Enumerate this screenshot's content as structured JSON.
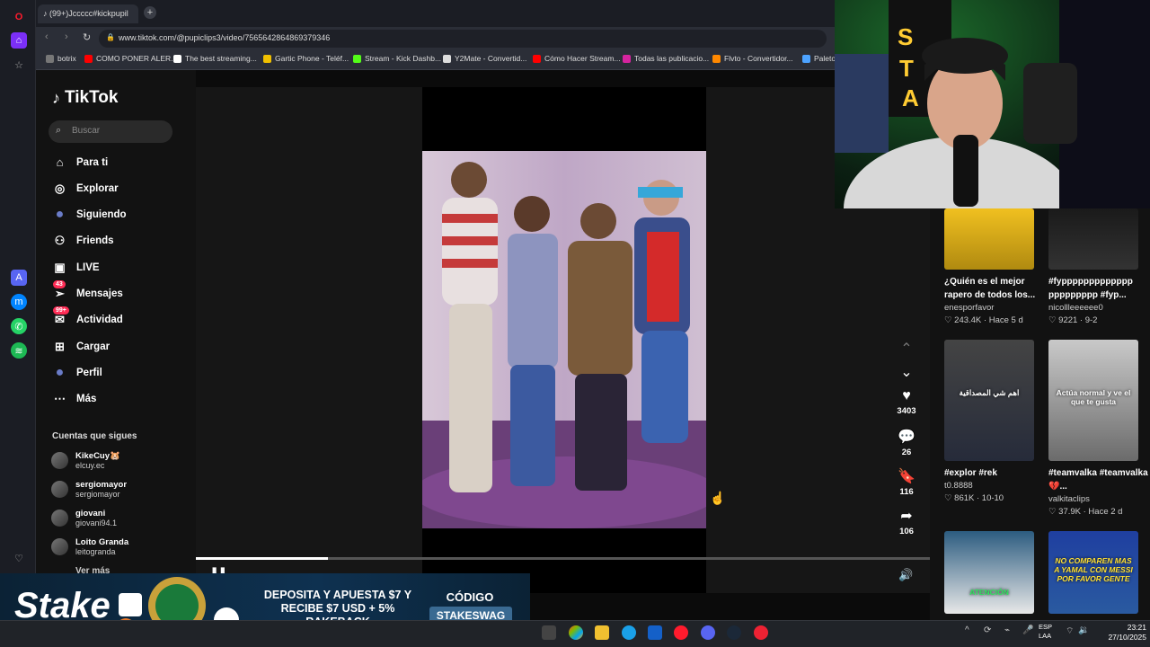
{
  "browser": {
    "tab_title": "(99+)Jccccc#kickpupil",
    "url": "www.tiktok.com/@pupiclips3/video/7565642864869379346",
    "bookmarks": [
      {
        "label": "botrix",
        "color": "#777777"
      },
      {
        "label": "COMO PONER ALER...",
        "color": "#ff0000"
      },
      {
        "label": "The best streaming...",
        "color": "#ffffff"
      },
      {
        "label": "Gartic Phone - Teléf...",
        "color": "#f0c000"
      },
      {
        "label": "Stream - Kick Dashb...",
        "color": "#53fc18"
      },
      {
        "label": "Y2Mate - Convertid...",
        "color": "#dddddd"
      },
      {
        "label": "Cómo Hacer Stream...",
        "color": "#ff0000"
      },
      {
        "label": "Todas las publicacio...",
        "color": "#d6249f"
      },
      {
        "label": "Flvto - Convertidor...",
        "color": "#ff8800"
      },
      {
        "label": "Paleto",
        "color": "#4da3ff"
      }
    ]
  },
  "tiktok": {
    "logo": "TikTok",
    "search_placeholder": "Buscar",
    "nav": [
      {
        "label": "Para ti",
        "icon": "home-icon"
      },
      {
        "label": "Explorar",
        "icon": "compass-icon"
      },
      {
        "label": "Siguiendo",
        "icon": "following-avatar-icon"
      },
      {
        "label": "Friends",
        "icon": "friends-icon"
      },
      {
        "label": "LIVE",
        "icon": "live-icon"
      },
      {
        "label": "Mensajes",
        "icon": "messages-icon",
        "badge": "43"
      },
      {
        "label": "Actividad",
        "icon": "activity-icon",
        "badge": "99+"
      },
      {
        "label": "Cargar",
        "icon": "upload-icon"
      },
      {
        "label": "Perfil",
        "icon": "profile-avatar-icon"
      },
      {
        "label": "Más",
        "icon": "more-icon"
      }
    ],
    "following_title": "Cuentas que sigues",
    "accounts": [
      {
        "name": "KikeCuy🐹",
        "handle": "elcuy.ec"
      },
      {
        "name": "sergiomayor",
        "handle": "sergiomayor"
      },
      {
        "name": "giovani",
        "handle": "giovani94.1"
      },
      {
        "name": "Loito Granda",
        "handle": "leitogranda"
      }
    ],
    "see_more": "Ver más",
    "actions": {
      "likes": "3403",
      "comments": "26",
      "saves": "116",
      "shares": "106"
    },
    "progress": 0.18,
    "related": [
      {
        "title": "¿Quién es el mejor rapero de todos los...",
        "author": "enesporfavor",
        "stats": "♡ 243.4K · Hace 5 d"
      },
      {
        "title": "#fyppppppppppppp ppppppppp #fyp...",
        "author": "nicollleeeeee0",
        "stats": "♡ 9221 · 9-2"
      },
      {
        "title": "#explor #rek",
        "author": "t0.8888",
        "stats": "♡ 861K · 10-10",
        "overlay": "اهم شي المصداقية"
      },
      {
        "title": "#teamvalka #teamvalka💔...",
        "author": "valkitaclips",
        "stats": "♡ 37.9K · Hace 2 d",
        "overlay": "Actúa normal y ve el que te gusta"
      },
      {
        "title": "",
        "author": "",
        "stats": "",
        "overlay": "ATENCIÓN"
      },
      {
        "title": "",
        "author": "",
        "stats": "",
        "overlay": "NO COMPAREN MAS A YAMAL CON MESSI POR FAVOR GENTE"
      }
    ]
  },
  "ad": {
    "brand": "Stake",
    "text": "DEPOSITA Y APUESTA $7 Y RECIBE $7 USD + 5% RAKEBACK",
    "code_label": "CÓDIGO",
    "code": "STAKESWAG"
  },
  "taskbar": {
    "lang_top": "ESP",
    "lang_bottom": "LAA",
    "time": "23:21",
    "date": "27/10/2025"
  }
}
